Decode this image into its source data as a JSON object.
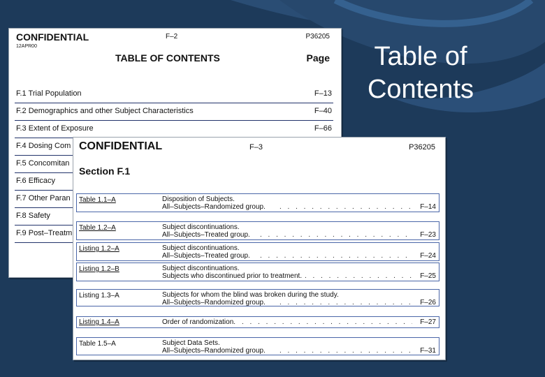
{
  "slide": {
    "title": "Table of Contents"
  },
  "doc1": {
    "confidential": "CONFIDENTIAL",
    "date_code": "12APR00",
    "page_label": "F–2",
    "protocol": "P36205",
    "toc_title": "TABLE OF CONTENTS",
    "page_header": "Page",
    "rows": [
      {
        "label": "F.1 Trial Population",
        "page": "F–13"
      },
      {
        "label": "F.2 Demographics and other Subject Characteristics",
        "page": "F–40"
      },
      {
        "label": "F.3 Extent of Exposure",
        "page": "F–66"
      },
      {
        "label": "F.4 Dosing Com",
        "page": ""
      },
      {
        "label": "F.5 Concomitan",
        "page": ""
      },
      {
        "label": "F.6 Efficacy",
        "page": ""
      },
      {
        "label": "F.7 Other Paran",
        "page": ""
      },
      {
        "label": "F.8 Safety",
        "page": ""
      },
      {
        "label": "F.9 Post–Treatm",
        "page": ""
      }
    ]
  },
  "doc2": {
    "confidential": "CONFIDENTIAL",
    "page_label": "F–3",
    "protocol": "P36205",
    "section": "Section F.1",
    "entries": [
      {
        "id": "Table 1.1–A",
        "line1": "Disposition of Subjects.",
        "line2": "All–Subjects–Randomized group.",
        "page": "F–14"
      },
      {
        "id": "Table 1.2–A",
        "line1": "Subject discontinuations.",
        "line2": "All–Subjects–Treated group.",
        "page": "F–23"
      },
      {
        "id": "Listing 1.2–A",
        "line1": "Subject discontinuations.",
        "line2": "All–Subjects–Treated group.",
        "page": "F–24"
      },
      {
        "id": "Listing 1.2–B",
        "line1": "Subject discontinuations.",
        "line2": "Subjects who discontinued prior to treatment.",
        "page": "F–25"
      },
      {
        "id": "Listing 1.3–A",
        "line1": "Subjects for whom the blind was broken during the study.",
        "line2": "All–Subjects–Randomized group.",
        "page": "F–26"
      },
      {
        "id": "Listing 1.4–A",
        "line1": "",
        "line2": "Order of randomization.",
        "page": "F–27"
      },
      {
        "id": "Table 1.5–A",
        "line1": "Subject Data Sets.",
        "line2": "All–Subjects–Randomized group.",
        "page": "F–31"
      }
    ]
  },
  "colors": {
    "background": "#1d3a5a",
    "rule": "#22336a",
    "box_border": "#4a66a8"
  }
}
